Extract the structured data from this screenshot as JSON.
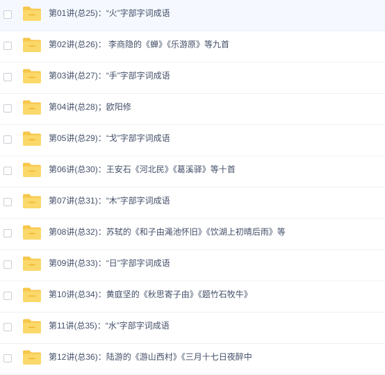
{
  "colors": {
    "folder_back": "#f7c64a",
    "folder_front": "#fbd86a",
    "folder_stripe": "#f0b830",
    "text": "#424e67",
    "divider": "#eef0f4"
  },
  "files": [
    {
      "name": "第01讲(总25)：“火”字部字词成语",
      "icon": "folder-icon"
    },
    {
      "name": "第02讲(总26)：   李商隐的《蝉》《乐游原》等九首",
      "icon": "folder-icon"
    },
    {
      "name": "第03讲(总27)：“手”字部字词成语",
      "icon": "folder-icon"
    },
    {
      "name": "第04讲(总28)；欧阳修",
      "icon": "folder-icon"
    },
    {
      "name": "第05讲(总29)：“戈”字部字词成语",
      "icon": "folder-icon"
    },
    {
      "name": "第06讲(总30)：王安石《河北民》《葛溪驿》等十首",
      "icon": "folder-icon"
    },
    {
      "name": "第07讲(总31)：“木”字部字词成语",
      "icon": "folder-icon"
    },
    {
      "name": "第08讲(总32)：苏轼的《和子由渑池怀旧》《饮湖上初晴后雨》等",
      "icon": "folder-icon"
    },
    {
      "name": "第09讲(总33)：“日”字部字词成语",
      "icon": "folder-icon"
    },
    {
      "name": "第10讲(总34)：黄庭坚的《秋思寄子由》《题竹石牧牛》",
      "icon": "folder-icon"
    },
    {
      "name": "第11讲(总35)：“水”字部字词成语",
      "icon": "folder-icon"
    },
    {
      "name": "第12讲(总36)：陆游的《游山西村》《三月十七日夜醉中",
      "icon": "folder-icon"
    }
  ]
}
